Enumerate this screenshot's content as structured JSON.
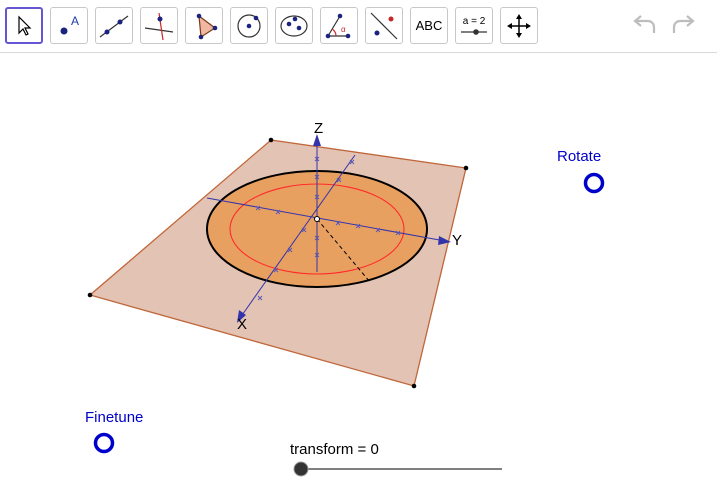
{
  "toolbar": {
    "tools": [
      {
        "name": "move-tool",
        "icon": "pointer-arrow-icon"
      },
      {
        "name": "point-tool",
        "icon": "point-icon",
        "label": "A"
      },
      {
        "name": "line-tool",
        "icon": "line-through-two-points-icon"
      },
      {
        "name": "perpendicular-line-tool",
        "icon": "perpendicular-line-icon"
      },
      {
        "name": "polygon-tool",
        "icon": "polygon-icon"
      },
      {
        "name": "circle-tool",
        "icon": "circle-center-point-icon"
      },
      {
        "name": "conic-tool",
        "icon": "ellipse-icon"
      },
      {
        "name": "angle-tool",
        "icon": "angle-icon",
        "label": "α"
      },
      {
        "name": "reflect-tool",
        "icon": "reflect-about-line-icon"
      },
      {
        "name": "text-tool",
        "icon": "text-icon",
        "label": "ABC"
      },
      {
        "name": "slider-tool",
        "icon": "slider-icon",
        "label": "a = 2"
      },
      {
        "name": "move-graphics-view-tool",
        "icon": "move-view-arrows-icon"
      }
    ],
    "undo_icon": "undo-icon",
    "redo_icon": "redo-icon"
  },
  "graphics": {
    "axis_labels": {
      "z": "Z",
      "y": "Y",
      "x": "X"
    },
    "rotate_label": "Rotate",
    "finetune_label": "Finetune",
    "slider": {
      "name": "transform",
      "value": 0,
      "label": "transform = 0"
    }
  },
  "colors": {
    "plane_fill": "#e3c3b3",
    "plane_edge": "#c0663a",
    "disc_fill": "#e8a060",
    "inner_circle": "#ff2a2a",
    "axis": "#3333aa",
    "accent": "#0000cc",
    "selected_tool_border": "#6557d2"
  }
}
